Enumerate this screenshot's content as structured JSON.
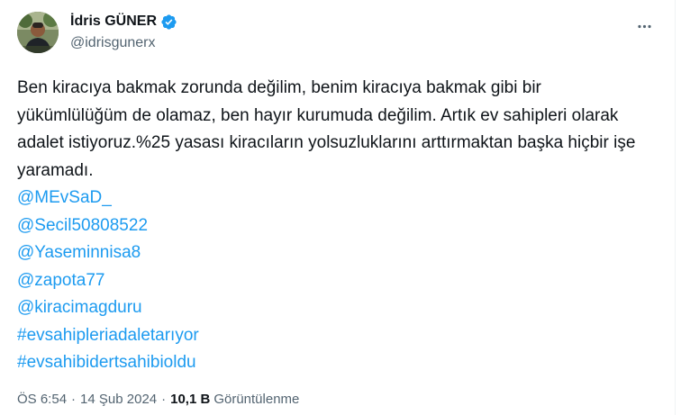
{
  "author": {
    "display_name": "İdris GÜNER",
    "handle": "@idrisgunerx",
    "verified": true
  },
  "tweet": {
    "text": "Ben kiracıya bakmak zorunda değilim, benim kiracıya bakmak gibi bir yükümlülüğüm de olamaz, ben hayır kurumuda değilim. Artık ev sahipleri olarak adalet istiyoruz.%25 yasası kiracıların yolsuzluklarını arttırmaktan başka hiçbir işe yaramadı.",
    "links": [
      "@MEvSaD_",
      "@Secil50808522",
      "@Yaseminnisa8",
      "@zapota77",
      "@kiracimagduru",
      "#evsahipleriadaletarıyor",
      "#evsahibidertsahibioldu"
    ]
  },
  "meta": {
    "time": "ÖS 6:54",
    "separator": "·",
    "date": "14 Şub 2024",
    "views_count": "10,1 B",
    "views_label": "Görüntülenme"
  },
  "colors": {
    "link": "#1d9bf0",
    "text": "#0f1419",
    "secondary": "#536471",
    "verified": "#1d9bf0"
  },
  "icons": {
    "verified": "verified-badge-icon",
    "more": "more-horizontal-icon"
  }
}
